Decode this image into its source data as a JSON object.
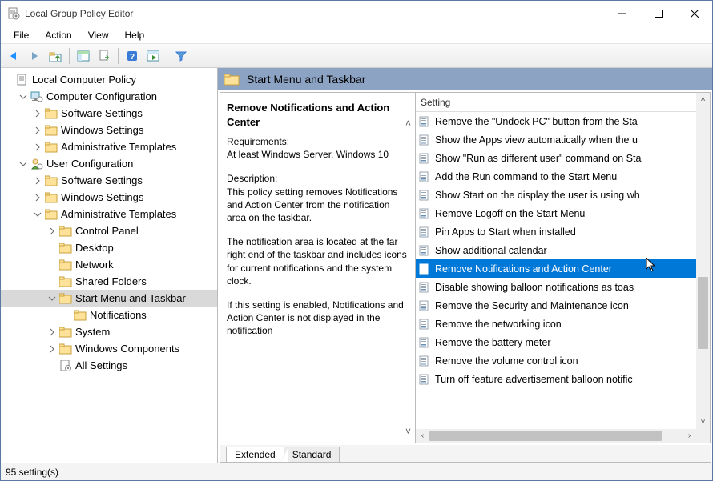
{
  "window": {
    "title": "Local Group Policy Editor"
  },
  "menus": [
    "File",
    "Action",
    "View",
    "Help"
  ],
  "tree": [
    {
      "depth": 0,
      "exp": "",
      "icon": "doc",
      "label": "Local Computer Policy"
    },
    {
      "depth": 1,
      "exp": "open",
      "icon": "comp",
      "label": "Computer Configuration"
    },
    {
      "depth": 2,
      "exp": "closed",
      "icon": "folder",
      "label": "Software Settings"
    },
    {
      "depth": 2,
      "exp": "closed",
      "icon": "folder",
      "label": "Windows Settings"
    },
    {
      "depth": 2,
      "exp": "closed",
      "icon": "folder",
      "label": "Administrative Templates"
    },
    {
      "depth": 1,
      "exp": "open",
      "icon": "user",
      "label": "User Configuration"
    },
    {
      "depth": 2,
      "exp": "closed",
      "icon": "folder",
      "label": "Software Settings"
    },
    {
      "depth": 2,
      "exp": "closed",
      "icon": "folder",
      "label": "Windows Settings"
    },
    {
      "depth": 2,
      "exp": "open",
      "icon": "folder",
      "label": "Administrative Templates"
    },
    {
      "depth": 3,
      "exp": "closed",
      "icon": "folder",
      "label": "Control Panel"
    },
    {
      "depth": 3,
      "exp": "",
      "icon": "folder",
      "label": "Desktop"
    },
    {
      "depth": 3,
      "exp": "",
      "icon": "folder",
      "label": "Network"
    },
    {
      "depth": 3,
      "exp": "",
      "icon": "folder",
      "label": "Shared Folders"
    },
    {
      "depth": 3,
      "exp": "open",
      "icon": "folder",
      "label": "Start Menu and Taskbar",
      "sel": true
    },
    {
      "depth": 4,
      "exp": "",
      "icon": "folder",
      "label": "Notifications"
    },
    {
      "depth": 3,
      "exp": "closed",
      "icon": "folder",
      "label": "System"
    },
    {
      "depth": 3,
      "exp": "closed",
      "icon": "folder",
      "label": "Windows Components"
    },
    {
      "depth": 3,
      "exp": "",
      "icon": "allset",
      "label": "All Settings"
    }
  ],
  "header_title": "Start Menu and Taskbar",
  "desc": {
    "title": "Remove Notifications and Action Center",
    "req_label": "Requirements:",
    "req": "At least Windows Server, Windows 10",
    "desc_label": "Description:",
    "p1": "This policy setting removes Notifications and Action Center from the notification area on the taskbar.",
    "p2": "The notification area is located at the far right end of the taskbar and includes icons for current notifications and the system clock.",
    "p3": "If this setting is enabled, Notifications and Action Center is not displayed in the notification"
  },
  "list_header": "Setting",
  "settings": [
    {
      "label": "Remove the \"Undock PC\" button from the Sta"
    },
    {
      "label": "Show the Apps view automatically when the u"
    },
    {
      "label": "Show \"Run as different user\" command on Sta"
    },
    {
      "label": "Add the Run command to the Start Menu"
    },
    {
      "label": "Show Start on the display the user is using wh"
    },
    {
      "label": "Remove Logoff on the Start Menu"
    },
    {
      "label": "Pin Apps to Start when installed"
    },
    {
      "label": "Show additional calendar"
    },
    {
      "label": "Remove Notifications and Action Center",
      "sel": true
    },
    {
      "label": "Disable showing balloon notifications as toas"
    },
    {
      "label": "Remove the Security and Maintenance icon"
    },
    {
      "label": "Remove the networking icon"
    },
    {
      "label": "Remove the battery meter"
    },
    {
      "label": "Remove the volume control icon"
    },
    {
      "label": "Turn off feature advertisement balloon notific"
    }
  ],
  "tabs": {
    "extended": "Extended",
    "standard": "Standard"
  },
  "status": "95 setting(s)"
}
